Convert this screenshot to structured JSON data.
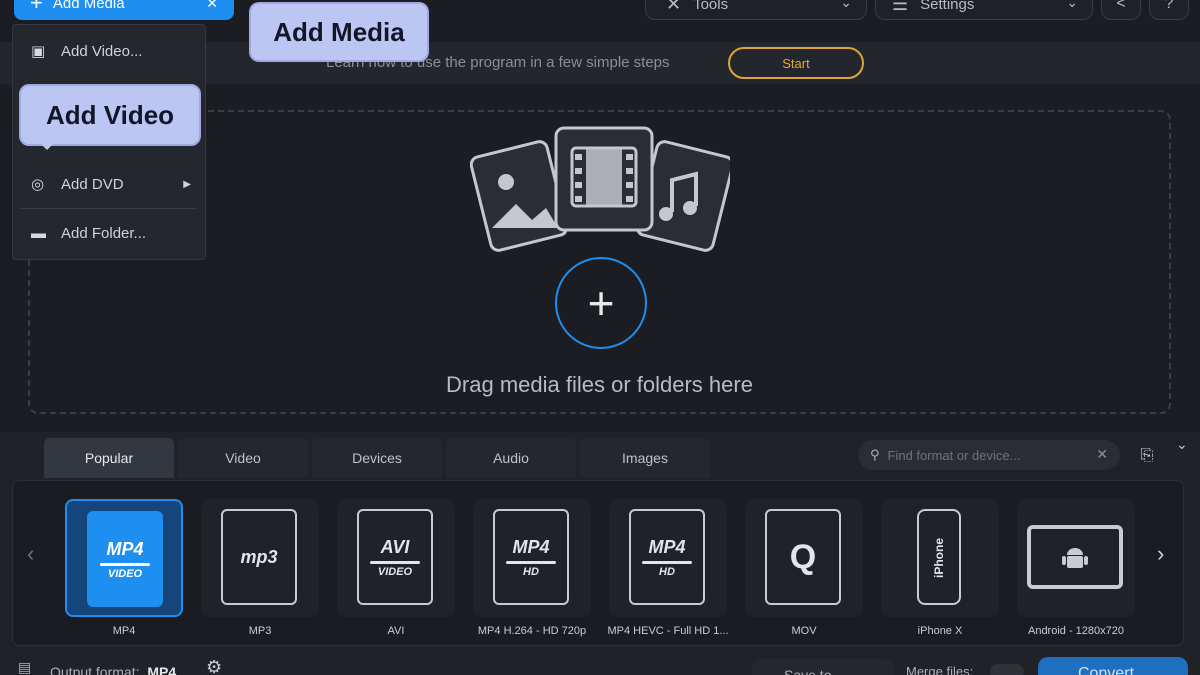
{
  "toolbar": {
    "add_media_label": "Add Media",
    "tools_label": "Tools",
    "settings_label": "Settings"
  },
  "tipbar": {
    "text": "Learn how to use the program in a few simple steps",
    "start_label": "Start"
  },
  "add_media_menu": {
    "items": [
      {
        "label": "Add Video...",
        "icon": "video-frame-icon"
      },
      {
        "label": "Add DVD",
        "icon": "dvd-icon"
      },
      {
        "label": "Add Folder...",
        "icon": "folder-icon"
      }
    ]
  },
  "callouts": {
    "add_media": "Add Media",
    "add_video": "Add Video"
  },
  "dropzone": {
    "text": "Drag media files or folders here"
  },
  "format_panel": {
    "tabs": [
      "Popular",
      "Video",
      "Devices",
      "Audio",
      "Images"
    ],
    "active_tab": "Popular",
    "search_placeholder": "Find format or device...",
    "formats": [
      {
        "label": "MP4",
        "card_main": "MP4",
        "card_sub": "VIDEO",
        "selected": true
      },
      {
        "label": "MP3",
        "card_main": "mp3",
        "card_sub": "",
        "selected": false
      },
      {
        "label": "AVI",
        "card_main": "AVI",
        "card_sub": "VIDEO",
        "selected": false
      },
      {
        "label": "MP4 H.264 - HD 720p",
        "card_main": "MP4",
        "card_sub": "HD",
        "selected": false
      },
      {
        "label": "MP4 HEVC - Full HD 1...",
        "card_main": "MP4",
        "card_sub": "HD",
        "selected": false
      },
      {
        "label": "MOV",
        "card_main": "Q",
        "card_sub": "",
        "selected": false
      },
      {
        "label": "iPhone X",
        "card_main": "iPhone",
        "card_sub": "",
        "selected": false
      },
      {
        "label": "Android - 1280x720",
        "card_main": "",
        "card_sub": "",
        "selected": false
      }
    ]
  },
  "bottombar": {
    "output_format_label": "Output format:",
    "output_format_value": "MP4",
    "save_to_label": "Save to...",
    "merge_files_label": "Merge files:",
    "convert_label": "Convert"
  },
  "colors": {
    "accent_blue": "#1e8ef0",
    "start_orange": "#e0a336",
    "callout_bg": "#bcc6f2",
    "background": "#1b1d22"
  }
}
